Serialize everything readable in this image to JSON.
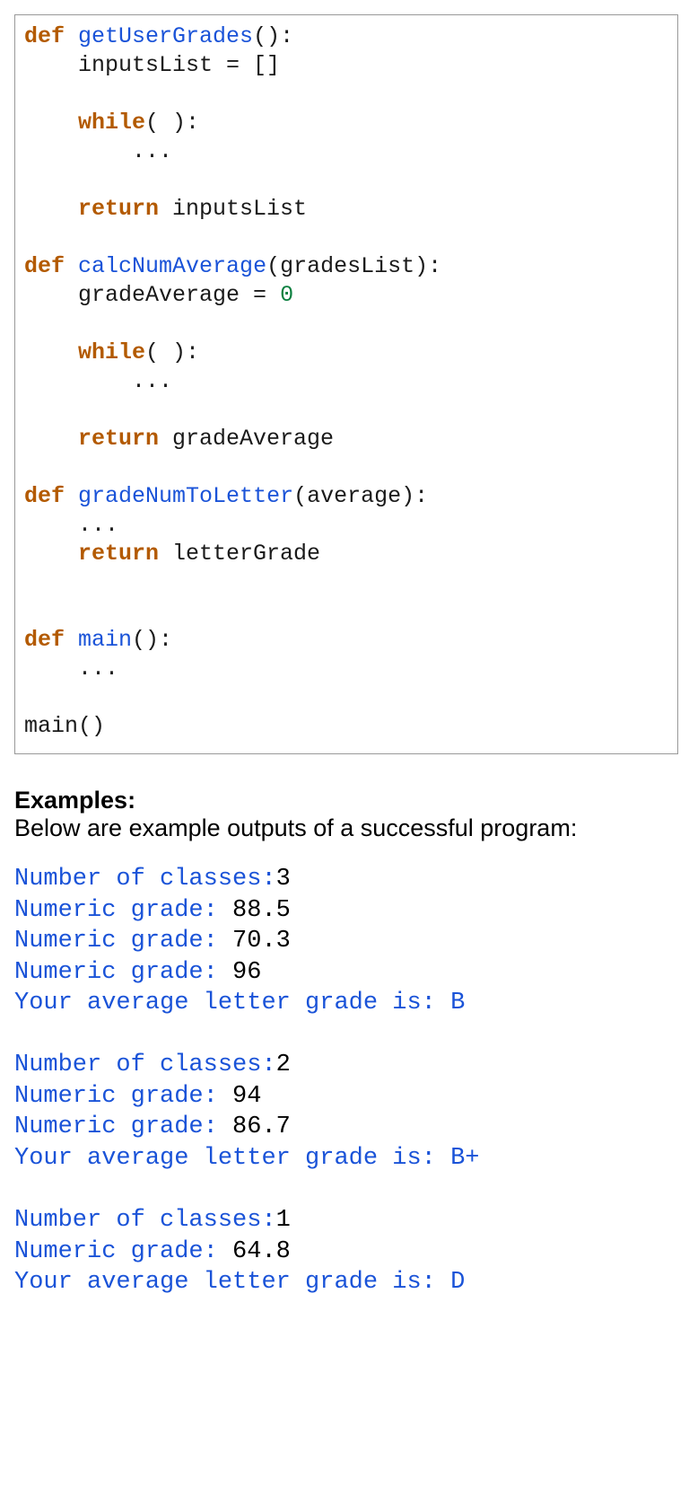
{
  "code": {
    "kw_def": "def",
    "kw_while": "while",
    "kw_return": "return",
    "fn_getUserGrades": "getUserGrades",
    "fn_calcNumAverage": "calcNumAverage",
    "fn_gradeNumToLetter": "gradeNumToLetter",
    "fn_main": "main",
    "ellipsis": "...",
    "sig_getUserGrades_rest": "():",
    "line_inputsList": "inputsList = []",
    "line_while": "( ):",
    "line_return_inputsList": " inputsList",
    "sig_calcNumAverage_rest": "(gradesList):",
    "line_gradeAverage": "gradeAverage = ",
    "zero": "0",
    "line_return_gradeAverage": " gradeAverage",
    "sig_gradeNumToLetter_rest": "(average):",
    "line_return_letterGrade": " letterGrade",
    "sig_main_rest": "():",
    "line_main_call": "main()"
  },
  "examples": {
    "heading": "Examples:",
    "intro": "Below are example outputs of a successful program:",
    "prompt_numClasses": "Number of classes:",
    "prompt_numericGrade": "Numeric grade: ",
    "msg_avg": "Your average letter grade is: ",
    "runs": [
      {
        "numClasses": "3",
        "grades": [
          "88.5",
          "70.3",
          "96"
        ],
        "result": "B"
      },
      {
        "numClasses": "2",
        "grades": [
          "94",
          "86.7"
        ],
        "result": "B+"
      },
      {
        "numClasses": "1",
        "grades": [
          "64.8"
        ],
        "result": "D"
      }
    ]
  }
}
